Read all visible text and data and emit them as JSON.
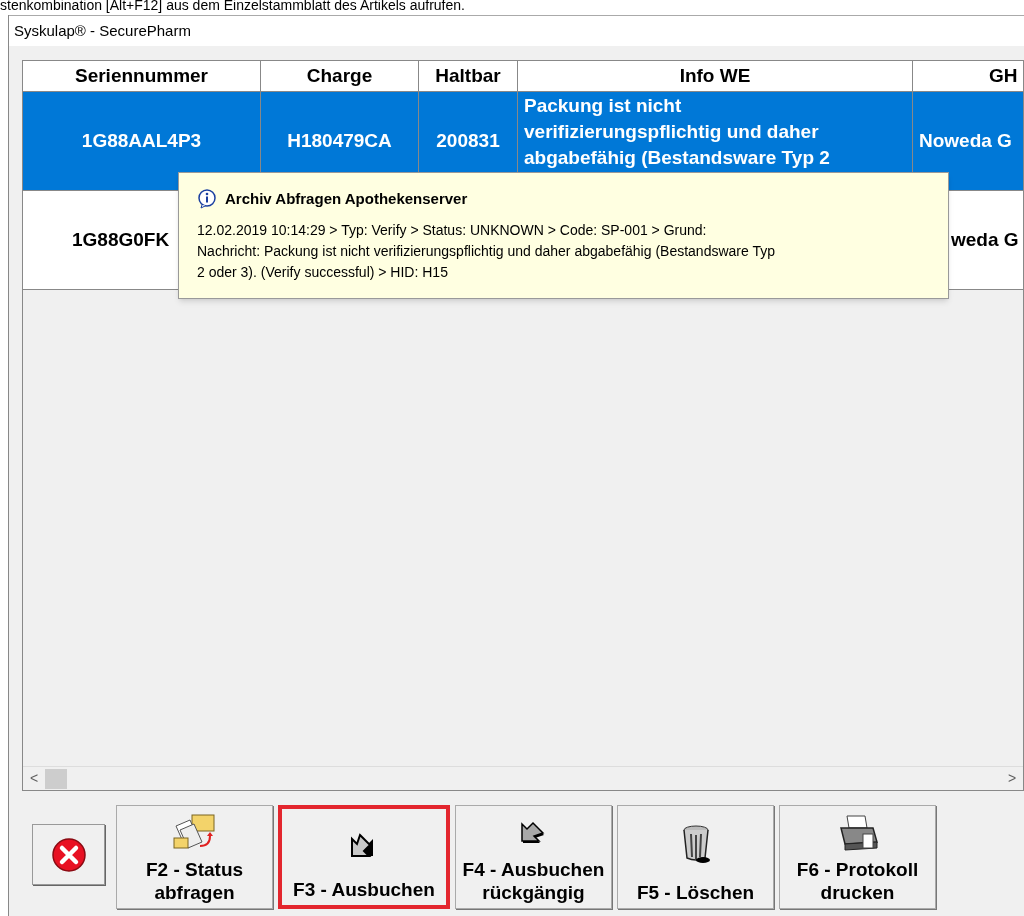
{
  "page_caption": "stenkombination [Alt+F12] aus dem Einzelstammblatt des Artikels aufrufen.",
  "window": {
    "title": "Syskulap® - SecurePharm"
  },
  "table": {
    "columns": [
      "Seriennummer",
      "Charge",
      "Haltbar",
      "Info WE",
      "GH"
    ],
    "rows": [
      {
        "selected": true,
        "cells": [
          "1G88AAL4P3",
          "H180479CA",
          "200831",
          "Packung ist nicht verifizierungspflichtig und daher abgabefähig (Bestandsware Typ 2",
          "Noweda G"
        ]
      },
      {
        "selected": false,
        "cells": [
          "1G88G0FK",
          null,
          null,
          null,
          "weda G"
        ]
      }
    ]
  },
  "tooltip": {
    "title": "Archiv Abfragen Apothekenserver",
    "lines": [
      "12.02.2019 10:14:29 > Typ: Verify > Status: UNKNOWN > Code: SP-001 > Grund:",
      "Nachricht: Packung ist nicht verifizierungspflichtig und daher abgabefähig (Bestandsware Typ",
      "2 oder 3).  (Verify successful) > HID: H15"
    ]
  },
  "scrollbar": {
    "left": "<",
    "right": ">"
  },
  "buttons": [
    {
      "kind": "close",
      "highlighted": false
    },
    {
      "kind": "status",
      "label": "F2 - Status abfragen",
      "highlighted": false
    },
    {
      "kind": "book",
      "label": "F3 - Ausbuchen",
      "highlighted": true
    },
    {
      "kind": "undo",
      "label": "F4 - Ausbuchen rückgängig",
      "highlighted": false
    },
    {
      "kind": "delete",
      "label": "F5 - Löschen",
      "highlighted": false
    },
    {
      "kind": "print",
      "label": "F6 - Protokoll drucken",
      "highlighted": false
    }
  ]
}
